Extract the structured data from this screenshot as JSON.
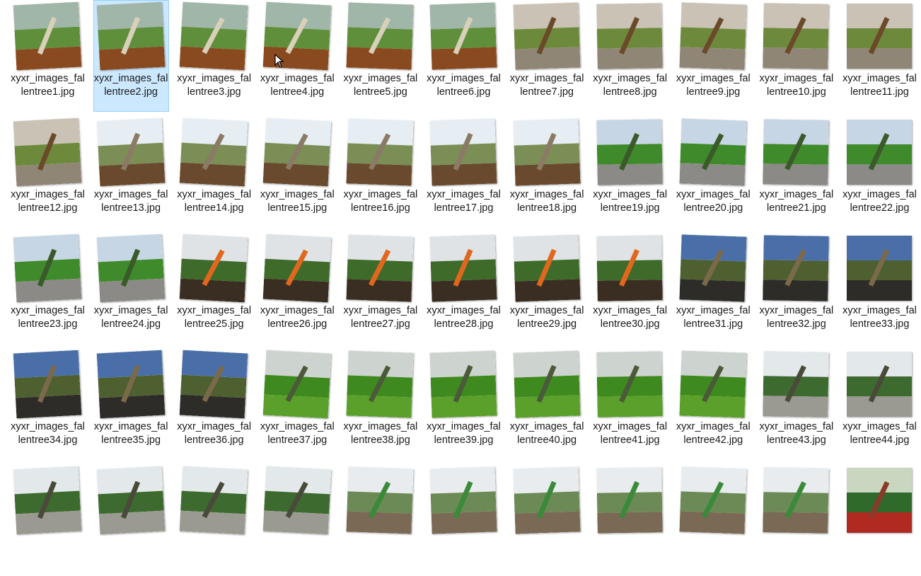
{
  "window": {
    "view": "file-explorer-large-icons"
  },
  "selected_file": "xyxr_images_fallentree2.jpg",
  "files": [
    {
      "name": "xyxr_images_fallentree1.jpg",
      "scene": "green"
    },
    {
      "name": "xyxr_images_fallentree2.jpg",
      "scene": "green"
    },
    {
      "name": "xyxr_images_fallentree3.jpg",
      "scene": "green"
    },
    {
      "name": "xyxr_images_fallentree4.jpg",
      "scene": "green"
    },
    {
      "name": "xyxr_images_fallentree5.jpg",
      "scene": "green"
    },
    {
      "name": "xyxr_images_fallentree6.jpg",
      "scene": "green"
    },
    {
      "name": "xyxr_images_fallentree7.jpg",
      "scene": "bench"
    },
    {
      "name": "xyxr_images_fallentree8.jpg",
      "scene": "bench"
    },
    {
      "name": "xyxr_images_fallentree9.jpg",
      "scene": "bench"
    },
    {
      "name": "xyxr_images_fallentree10.jpg",
      "scene": "bench"
    },
    {
      "name": "xyxr_images_fallentree11.jpg",
      "scene": "bench"
    },
    {
      "name": "xyxr_images_fallentree12.jpg",
      "scene": "bench"
    },
    {
      "name": "xyxr_images_fallentree13.jpg",
      "scene": "roots"
    },
    {
      "name": "xyxr_images_fallentree14.jpg",
      "scene": "roots"
    },
    {
      "name": "xyxr_images_fallentree15.jpg",
      "scene": "roots"
    },
    {
      "name": "xyxr_images_fallentree16.jpg",
      "scene": "roots"
    },
    {
      "name": "xyxr_images_fallentree17.jpg",
      "scene": "roots"
    },
    {
      "name": "xyxr_images_fallentree18.jpg",
      "scene": "roots"
    },
    {
      "name": "xyxr_images_fallentree19.jpg",
      "scene": "street"
    },
    {
      "name": "xyxr_images_fallentree20.jpg",
      "scene": "street"
    },
    {
      "name": "xyxr_images_fallentree21.jpg",
      "scene": "street"
    },
    {
      "name": "xyxr_images_fallentree22.jpg",
      "scene": "street"
    },
    {
      "name": "xyxr_images_fallentree23.jpg",
      "scene": "street"
    },
    {
      "name": "xyxr_images_fallentree24.jpg",
      "scene": "street"
    },
    {
      "name": "xyxr_images_fallentree25.jpg",
      "scene": "workers"
    },
    {
      "name": "xyxr_images_fallentree26.jpg",
      "scene": "workers"
    },
    {
      "name": "xyxr_images_fallentree27.jpg",
      "scene": "workers"
    },
    {
      "name": "xyxr_images_fallentree28.jpg",
      "scene": "workers"
    },
    {
      "name": "xyxr_images_fallentree29.jpg",
      "scene": "workers"
    },
    {
      "name": "xyxr_images_fallentree30.jpg",
      "scene": "workers"
    },
    {
      "name": "xyxr_images_fallentree31.jpg",
      "scene": "night"
    },
    {
      "name": "xyxr_images_fallentree32.jpg",
      "scene": "night"
    },
    {
      "name": "xyxr_images_fallentree33.jpg",
      "scene": "night"
    },
    {
      "name": "xyxr_images_fallentree34.jpg",
      "scene": "night"
    },
    {
      "name": "xyxr_images_fallentree35.jpg",
      "scene": "night"
    },
    {
      "name": "xyxr_images_fallentree36.jpg",
      "scene": "night"
    },
    {
      "name": "xyxr_images_fallentree37.jpg",
      "scene": "bush"
    },
    {
      "name": "xyxr_images_fallentree38.jpg",
      "scene": "bush"
    },
    {
      "name": "xyxr_images_fallentree39.jpg",
      "scene": "bush"
    },
    {
      "name": "xyxr_images_fallentree40.jpg",
      "scene": "bush"
    },
    {
      "name": "xyxr_images_fallentree41.jpg",
      "scene": "bush"
    },
    {
      "name": "xyxr_images_fallentree42.jpg",
      "scene": "bush"
    },
    {
      "name": "xyxr_images_fallentree43.jpg",
      "scene": "avenue"
    },
    {
      "name": "xyxr_images_fallentree44.jpg",
      "scene": "avenue"
    },
    {
      "name": "",
      "scene": "avenue"
    },
    {
      "name": "",
      "scene": "avenue"
    },
    {
      "name": "",
      "scene": "avenue"
    },
    {
      "name": "",
      "scene": "avenue"
    },
    {
      "name": "",
      "scene": "collage"
    },
    {
      "name": "",
      "scene": "collage"
    },
    {
      "name": "",
      "scene": "collage"
    },
    {
      "name": "",
      "scene": "collage"
    },
    {
      "name": "",
      "scene": "collage"
    },
    {
      "name": "",
      "scene": "collage"
    },
    {
      "name": "",
      "scene": "red"
    }
  ],
  "scene_colors": {
    "green": {
      "sky": "#9fb6a8",
      "mid": "#5f8f3a",
      "ground": "#8a4a1f",
      "trunk": "#d8d0b8"
    },
    "bench": {
      "sky": "#c9c2b5",
      "mid": "#6d8a3c",
      "ground": "#8f8676",
      "trunk": "#6b4a2a"
    },
    "roots": {
      "sky": "#e6eef4",
      "mid": "#7a8e55",
      "ground": "#6a4a2e",
      "trunk": "#8a7a66"
    },
    "street": {
      "sky": "#c7d6e4",
      "mid": "#3f8a2a",
      "ground": "#8b8a86",
      "trunk": "#3a5a2a"
    },
    "workers": {
      "sky": "#dfe3e6",
      "mid": "#3e6a2a",
      "ground": "#3a2e22",
      "trunk": "#e0681e"
    },
    "night": {
      "sky": "#4a6fa8",
      "mid": "#4f6030",
      "ground": "#2e2c28",
      "trunk": "#7a6a4a"
    },
    "bush": {
      "sky": "#cdd3cf",
      "mid": "#3f8a1e",
      "ground": "#5aa02a",
      "trunk": "#4a5a3a"
    },
    "avenue": {
      "sky": "#e3e8ea",
      "mid": "#3d6a2e",
      "ground": "#9a9a92",
      "trunk": "#4a4a3a"
    },
    "collage": {
      "sky": "#e9ecef",
      "mid": "#6b8a55",
      "ground": "#7a6a55",
      "trunk": "#3a8a3a"
    },
    "red": {
      "sky": "#c9d7c0",
      "mid": "#2f6a2a",
      "ground": "#b02a22",
      "trunk": "#8a3a2a"
    }
  }
}
